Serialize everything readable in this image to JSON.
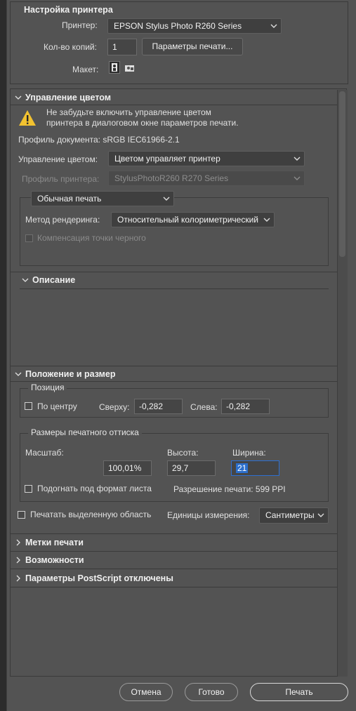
{
  "printer_setup": {
    "title": "Настройка принтера",
    "printer_label": "Принтер:",
    "printer_value": "EPSON Stylus Photo R260 Series",
    "copies_label": "Кол-во копий:",
    "copies_value": "1",
    "print_settings_button": "Параметры печати...",
    "layout_label": "Макет:"
  },
  "color_management": {
    "title": "Управление цветом",
    "warning_line1": "Не забудьте включить управление цветом",
    "warning_line2": "принтера в диалоговом окне параметров печати.",
    "doc_profile": "Профиль документа: sRGB IEC61966-2.1",
    "cm_label": "Управление цветом:",
    "cm_value": "Цветом управляет принтер",
    "printer_profile_label": "Профиль принтера:",
    "printer_profile_value": "StylusPhotoR260 R270 Series",
    "print_mode_value": "Обычная печать",
    "rendering_label": "Метод рендеринга:",
    "rendering_value": "Относительный колориметрический",
    "black_point_label": "Компенсация точки черного"
  },
  "description": {
    "title": "Описание"
  },
  "position_size": {
    "title": "Положение и размер",
    "position_legend": "Позиция",
    "center_label": "По центру",
    "top_label": "Сверху:",
    "top_value": "-0,282",
    "left_label": "Слева:",
    "left_value": "-0,282",
    "size_legend": "Размеры печатного оттиска",
    "scale_label": "Масштаб:",
    "scale_value": "100,01%",
    "height_label": "Высота:",
    "height_value": "29,7",
    "width_label": "Ширина:",
    "width_value": "21",
    "fit_label": "Подогнать под формат листа",
    "resolution": "Разрешение печати: 599 PPI",
    "print_selected_label": "Печатать выделенную область",
    "units_label": "Единицы измерения:",
    "units_value": "Сантиметры"
  },
  "collapsed_sections": {
    "marks": "Метки печати",
    "features": "Возможности",
    "postscript": "Параметры PostScript отключены"
  },
  "footer": {
    "cancel": "Отмена",
    "done": "Готово",
    "print": "Печать"
  },
  "icons": {
    "warning": "warning-triangle-icon",
    "portrait": "portrait-layout-icon",
    "landscape": "landscape-layout-icon",
    "chevron": "chevron-down-icon",
    "expand": "chevron-right-icon"
  },
  "colors": {
    "background": "#535353",
    "warning": "#f2c230",
    "selection": "#2c6fcc"
  }
}
